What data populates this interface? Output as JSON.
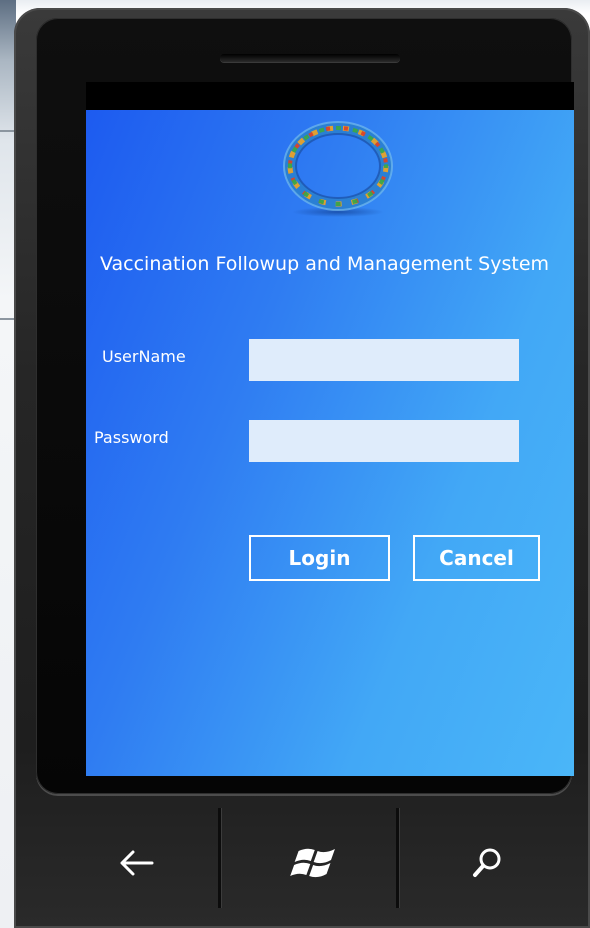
{
  "app": {
    "title": "Vaccination Followup and Management System",
    "logo_icon": "ring-logo-icon",
    "accent_colors": {
      "background_start": "#1d5bf0",
      "background_end": "#4ab6f8",
      "input_fill": "#dfecfb",
      "text": "#ffffff"
    }
  },
  "form": {
    "username_label": "UserName",
    "username_value": "",
    "password_label": "Password",
    "password_value": "",
    "login_label": "Login",
    "cancel_label": "Cancel"
  },
  "hardware": {
    "back_icon": "back-arrow-icon",
    "start_icon": "windows-logo-icon",
    "search_icon": "search-icon"
  }
}
